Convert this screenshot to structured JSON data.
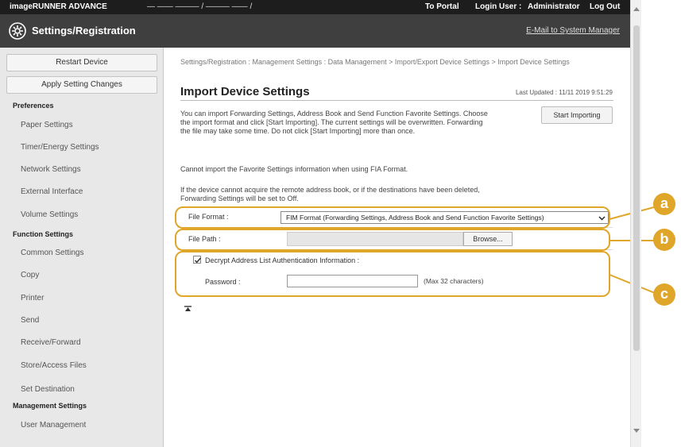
{
  "topbar": {
    "brand": "imageRUNNER ADVANCE",
    "device_name": "— —— ——— / ——— —— /",
    "to_portal": "To Portal",
    "login_user_label": "Login User :",
    "login_user": "Administrator",
    "log_out": "Log Out"
  },
  "titlebar": {
    "title": "Settings/Registration",
    "email_link": "E-Mail to System Manager"
  },
  "sidebar": {
    "restart_button": "Restart Device",
    "apply_button": "Apply Setting Changes",
    "sections": [
      {
        "label": "Preferences",
        "items": [
          "Paper Settings",
          "Timer/Energy Settings",
          "Network Settings",
          "External Interface",
          "Volume Settings"
        ]
      },
      {
        "label": "Function Settings",
        "items": [
          "Common Settings",
          "Copy",
          "Printer",
          "Send",
          "Receive/Forward",
          "Store/Access Files",
          "Set Destination"
        ]
      },
      {
        "label": "Management Settings",
        "items": [
          "User Management"
        ]
      }
    ]
  },
  "main": {
    "breadcrumb": "Settings/Registration : Management Settings : Data Management > Import/Export Device Settings > Import Device Settings",
    "title": "Import Device Settings",
    "last_updated": "Last Updated : 11/11 2019 9:51:29",
    "start_button": "Start Importing",
    "description_1": "You can import Forwarding Settings, Address Book and Send Function Favorite Settings. Choose the import format and click [Start Importing]. The current settings will be overwritten. Forwarding the file may take some time. Do not click [Start Importing] more than once.",
    "description_2": "Cannot import the Favorite Settings information when using FIA Format.",
    "description_3": "If the device cannot acquire the remote address book, or if the destinations have been deleted, Forwarding Settings will be set to Off.",
    "file_format_label": "File Format :",
    "file_format_value": "FIM Format (Forwarding Settings, Address Book and Send Function Favorite Settings)",
    "file_path_label": "File Path :",
    "browse_button": "Browse...",
    "decrypt_label": "Decrypt Address List Authentication Information :",
    "decrypt_checked": true,
    "password_label": "Password :",
    "password_value": "",
    "password_hint": "(Max 32 characters)"
  },
  "callouts": [
    "a",
    "b",
    "c"
  ],
  "colors": {
    "callout": "#e0a62a",
    "topbar": "#1d1d1d",
    "titlebar": "#3f3f3f",
    "sidebar": "#e8e8e8"
  }
}
